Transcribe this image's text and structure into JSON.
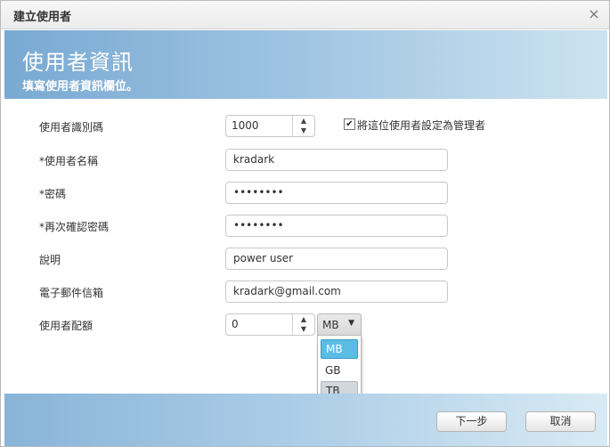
{
  "dialog": {
    "title": "建立使用者"
  },
  "header": {
    "title": "使用者資訊",
    "subtitle": "填寫使用者資訊欄位。"
  },
  "form": {
    "uid": {
      "label": "使用者識別碼",
      "value": "1000"
    },
    "admin_checkbox": {
      "label": "將這位使用者設定為管理者",
      "checked": true,
      "mark": "✔"
    },
    "username": {
      "label": "*使用者名稱",
      "value": "kradark"
    },
    "password": {
      "label": "*密碼",
      "value": "••••••••"
    },
    "confirm_password": {
      "label": "*再次確認密碼",
      "value": "••••••••"
    },
    "description": {
      "label": "說明",
      "value": "power user"
    },
    "email": {
      "label": "電子郵件信箱",
      "value": "kradark@gmail.com"
    },
    "quota": {
      "label": "使用者配額",
      "value": "0",
      "unit": "MB",
      "unit_options": [
        "MB",
        "GB",
        "TB"
      ]
    }
  },
  "spinner": {
    "up": "▲",
    "down": "▼"
  },
  "icons": {
    "close": "×",
    "caret": "▼"
  },
  "buttons": {
    "next": "下一步",
    "cancel": "取消"
  },
  "colors": {
    "header_start": "#79a9d2",
    "header_end": "#cde3f0",
    "selected_option": "#5bbde3"
  }
}
